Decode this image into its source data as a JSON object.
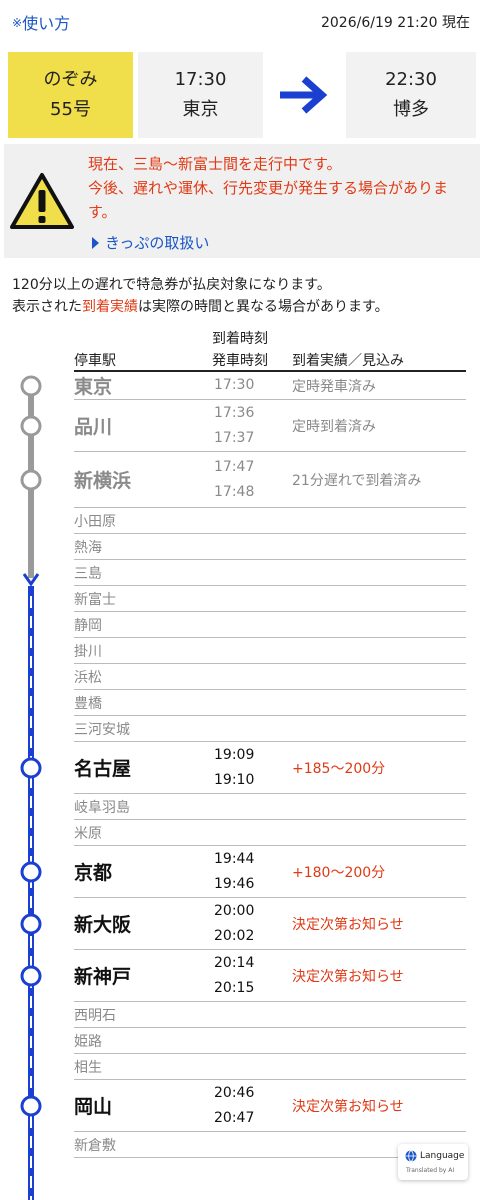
{
  "topbar": {
    "howto_mark": "※",
    "howto_label": "使い方",
    "now": "2026/6/19 21:20 現在"
  },
  "train": {
    "name": "のぞみ",
    "number": "55号"
  },
  "departure": {
    "time": "17:30",
    "station": "東京"
  },
  "arrival": {
    "time": "22:30",
    "station": "博多"
  },
  "alert": {
    "line1": "現在、三島～新富士間を走行中です。",
    "line2": "今後、遅れや運休、行先変更が発生する場合があります。",
    "ticket_link": "きっぷの取扱い"
  },
  "notes": {
    "line1": "120分以上の遅れで特急券が払戻対象になります。",
    "line2_pre": "表示された",
    "line2_hl": "到着実績",
    "line2_post": "は実際の時間と異なる場合があります。"
  },
  "table_header": {
    "station": "停車駅",
    "arr": "到着時刻",
    "dep": "発車時刻",
    "status": "到着実績／見込み"
  },
  "stations": [
    {
      "name": "東京",
      "kind": "past",
      "dep": "17:30",
      "status": "定時発車済み"
    },
    {
      "name": "品川",
      "kind": "past",
      "arr": "17:36",
      "dep": "17:37",
      "status": "定時到着済み"
    },
    {
      "name": "新横浜",
      "kind": "past",
      "arr": "17:47",
      "dep": "17:48",
      "status": "21分遅れで到着済み"
    },
    {
      "name": "小田原",
      "kind": "minor"
    },
    {
      "name": "熱海",
      "kind": "minor"
    },
    {
      "name": "三島",
      "kind": "minor"
    },
    {
      "name": "新富士",
      "kind": "minor"
    },
    {
      "name": "静岡",
      "kind": "minor"
    },
    {
      "name": "掛川",
      "kind": "minor"
    },
    {
      "name": "浜松",
      "kind": "minor"
    },
    {
      "name": "豊橋",
      "kind": "minor"
    },
    {
      "name": "三河安城",
      "kind": "minor"
    },
    {
      "name": "名古屋",
      "kind": "major",
      "arr": "19:09",
      "dep": "19:10",
      "status": "+185～200分"
    },
    {
      "name": "岐阜羽島",
      "kind": "minor"
    },
    {
      "name": "米原",
      "kind": "minor"
    },
    {
      "name": "京都",
      "kind": "major",
      "arr": "19:44",
      "dep": "19:46",
      "status": "+180～200分"
    },
    {
      "name": "新大阪",
      "kind": "major",
      "arr": "20:00",
      "dep": "20:02",
      "status": "決定次第お知らせ"
    },
    {
      "name": "新神戸",
      "kind": "major",
      "arr": "20:14",
      "dep": "20:15",
      "status": "決定次第お知らせ"
    },
    {
      "name": "西明石",
      "kind": "minor"
    },
    {
      "name": "姫路",
      "kind": "minor"
    },
    {
      "name": "相生",
      "kind": "minor"
    },
    {
      "name": "岡山",
      "kind": "major",
      "arr": "20:46",
      "dep": "20:47",
      "status": "決定次第お知らせ"
    },
    {
      "name": "新倉敷",
      "kind": "minor"
    }
  ],
  "language": {
    "label": "Language",
    "sub": "Translated by AI"
  },
  "colors": {
    "accent": "#1a56c8",
    "train_box": "#f0de4a",
    "alert_text": "#e03a16",
    "passed_line": "#9a9a9a"
  }
}
